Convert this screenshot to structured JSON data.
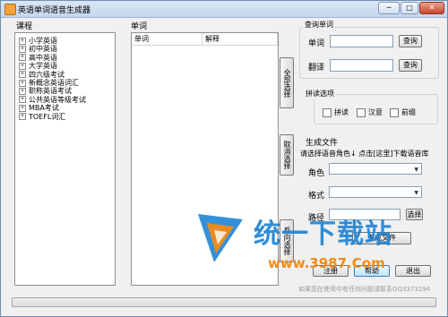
{
  "window": {
    "title": "英语单词语音生成器",
    "controls": {
      "minimize": "─",
      "maximize": "□",
      "close": "✕"
    }
  },
  "course": {
    "label": "课程",
    "items": [
      "小学英语",
      "初中英语",
      "高中英语",
      "大学英语",
      "四六级考试",
      "新概念英语词汇",
      "职称英语考试",
      "公共英语等级考试",
      "MBA考试",
      "TOEFL词汇"
    ]
  },
  "words": {
    "label": "单词",
    "columns": [
      "单词",
      "解释"
    ]
  },
  "side_buttons": {
    "select_all": "全部选择",
    "deselect": "取消选择",
    "invert": "反向选择"
  },
  "lookup": {
    "title": "查询单词",
    "word_label": "单词",
    "translate_label": "翻译",
    "query_button": "查询",
    "word_value": "",
    "translate_value": ""
  },
  "read_options": {
    "title": "拼读选项",
    "options": [
      "拼读",
      "汉意",
      "前缀"
    ]
  },
  "generate": {
    "title": "生成文件",
    "hint": "请选择语音角色↓  点击[这里]下载语音库",
    "role_label": "角色",
    "format_label": "格式",
    "path_label": "路径",
    "role_value": "",
    "format_value": "",
    "path_value": "",
    "choose_button": "选择",
    "generate_button": "生成文件"
  },
  "bottom_buttons": {
    "register": "注册",
    "help": "帮助",
    "exit": "退出"
  },
  "footer_note": "如果您在使用中有任何问题请联系QQ3373294",
  "watermark": {
    "text": "统一下载站",
    "url": "www.3987.Com"
  },
  "progress": {
    "value": 0
  },
  "colors": {
    "title_bar": "#c4d6ee",
    "watermark_blue": "#1f84d6",
    "watermark_orange": "#f28c18"
  }
}
